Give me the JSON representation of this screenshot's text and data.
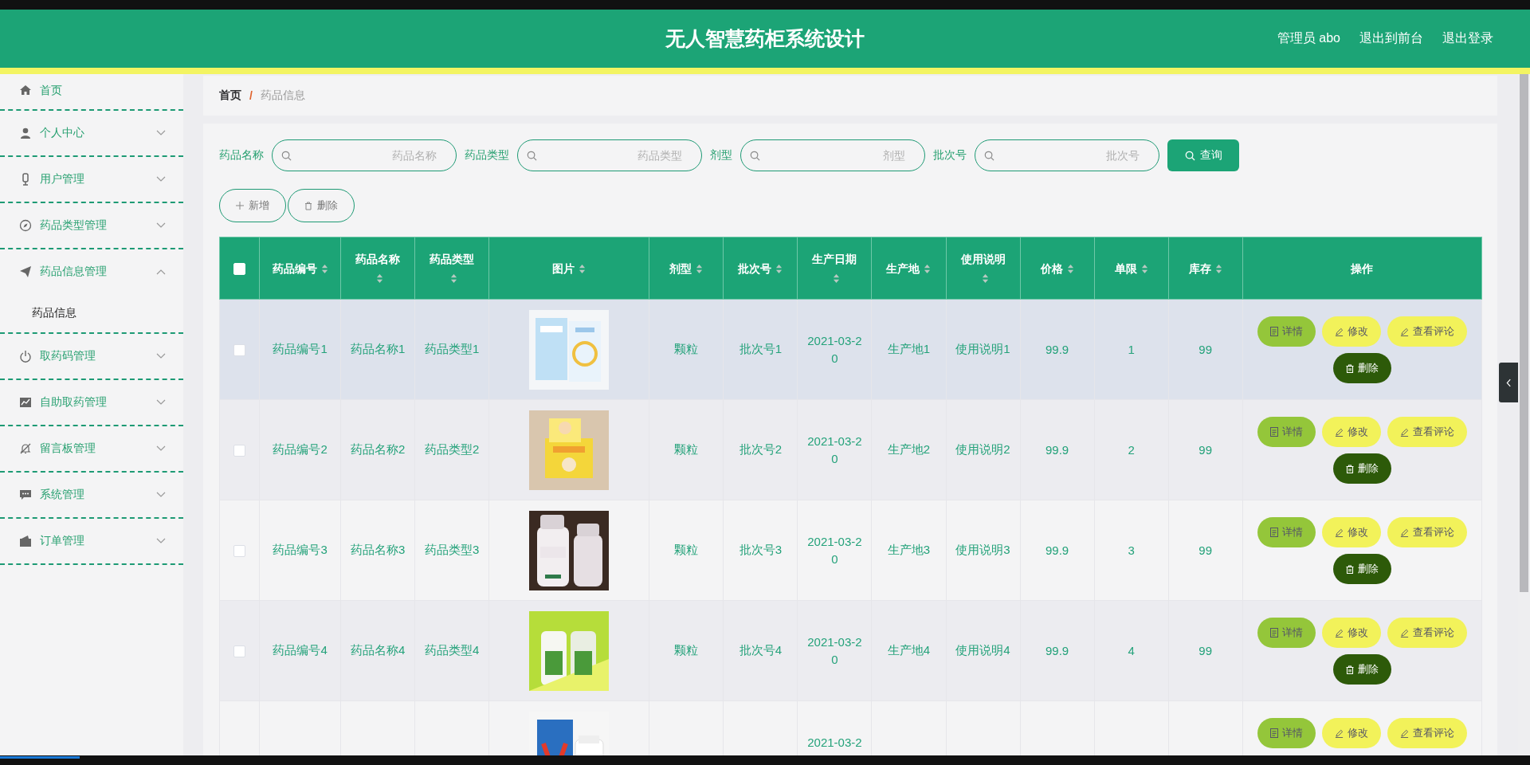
{
  "header": {
    "title": "无人智慧药柜系统设计",
    "links": [
      "管理员 abo",
      "退出到前台",
      "退出登录"
    ]
  },
  "sidebar": {
    "items": [
      {
        "label": "首页",
        "kind": "link"
      },
      {
        "label": "个人中心",
        "kind": "menu",
        "expanded": false
      },
      {
        "label": "用户管理",
        "kind": "menu",
        "expanded": false
      },
      {
        "label": "药品类型管理",
        "kind": "menu",
        "expanded": false
      },
      {
        "label": "药品信息管理",
        "kind": "menu",
        "expanded": true,
        "children": [
          {
            "label": "药品信息"
          }
        ]
      },
      {
        "label": "取药码管理",
        "kind": "menu",
        "expanded": false
      },
      {
        "label": "自助取药管理",
        "kind": "menu",
        "expanded": false
      },
      {
        "label": "留言板管理",
        "kind": "menu",
        "expanded": false
      },
      {
        "label": "系统管理",
        "kind": "menu",
        "expanded": false
      },
      {
        "label": "订单管理",
        "kind": "menu",
        "expanded": false
      }
    ]
  },
  "breadcrumb": [
    "首页",
    "/",
    "药品信息"
  ],
  "search": {
    "fields": [
      {
        "label": "药品名称",
        "placeholder": "药品名称"
      },
      {
        "label": "药品类型",
        "placeholder": "药品类型"
      },
      {
        "label": "剂型",
        "placeholder": "剂型"
      },
      {
        "label": "批次号",
        "placeholder": "批次号"
      }
    ],
    "button": "查询"
  },
  "toolbar": [
    {
      "label": "新增",
      "kind": "add"
    },
    {
      "label": "删除",
      "kind": "delete"
    }
  ],
  "table": {
    "all_checked": false,
    "columns": [
      {
        "label": "药品编号",
        "sortable": true
      },
      {
        "label": "药品名称",
        "sortable": true
      },
      {
        "label": "药品类型",
        "sortable": true
      },
      {
        "label": "图片",
        "sortable": true
      },
      {
        "label": "剂型",
        "sortable": true
      },
      {
        "label": "批次号",
        "sortable": true
      },
      {
        "label": "生产日期",
        "sortable": true
      },
      {
        "label": "生产地",
        "sortable": true
      },
      {
        "label": "使用说明",
        "sortable": true
      },
      {
        "label": "价格",
        "sortable": true
      },
      {
        "label": "单限",
        "sortable": true
      },
      {
        "label": "库存",
        "sortable": true
      },
      {
        "label": "操作",
        "sortable": false
      }
    ],
    "rows": [
      {
        "checked": false,
        "hovered": true,
        "cells": [
          "药品编号1",
          "药品名称1",
          "药品类型1",
          null,
          "颗粒",
          "批次号1",
          "2021-03-20",
          "生产地1",
          "使用说明1",
          "99.9",
          "1",
          "99"
        ],
        "actions": [
          {
            "label": "详情",
            "kind": "detail"
          },
          {
            "label": "修改",
            "kind": "edit"
          },
          {
            "label": "查看评论",
            "kind": "edit"
          },
          {
            "label": "删除",
            "kind": "delete"
          }
        ]
      },
      {
        "checked": false,
        "hovered": false,
        "cells": [
          "药品编号2",
          "药品名称2",
          "药品类型2",
          null,
          "颗粒",
          "批次号2",
          "2021-03-20",
          "生产地2",
          "使用说明2",
          "99.9",
          "2",
          "99"
        ],
        "actions": [
          {
            "label": "详情",
            "kind": "detail"
          },
          {
            "label": "修改",
            "kind": "edit"
          },
          {
            "label": "查看评论",
            "kind": "edit"
          },
          {
            "label": "删除",
            "kind": "delete"
          }
        ]
      },
      {
        "checked": false,
        "hovered": false,
        "cells": [
          "药品编号3",
          "药品名称3",
          "药品类型3",
          null,
          "颗粒",
          "批次号3",
          "2021-03-20",
          "生产地3",
          "使用说明3",
          "99.9",
          "3",
          "99"
        ],
        "actions": [
          {
            "label": "详情",
            "kind": "detail"
          },
          {
            "label": "修改",
            "kind": "edit"
          },
          {
            "label": "查看评论",
            "kind": "edit"
          },
          {
            "label": "删除",
            "kind": "delete"
          }
        ]
      },
      {
        "checked": false,
        "hovered": false,
        "cells": [
          "药品编号4",
          "药品名称4",
          "药品类型4",
          null,
          "颗粒",
          "批次号4",
          "2021-03-20",
          "生产地4",
          "使用说明4",
          "99.9",
          "4",
          "99"
        ],
        "actions": [
          {
            "label": "详情",
            "kind": "detail"
          },
          {
            "label": "修改",
            "kind": "edit"
          },
          {
            "label": "查看评论",
            "kind": "edit"
          },
          {
            "label": "删除",
            "kind": "delete"
          }
        ]
      },
      {
        "hovered": false,
        "cells": [
          null,
          null,
          null,
          null,
          null,
          null,
          "2021-03-2",
          null,
          null,
          null,
          null,
          null
        ],
        "actions": [
          {
            "label": "详情",
            "kind": "detail"
          },
          {
            "label": "修改",
            "kind": "edit"
          },
          {
            "label": "查看评论",
            "kind": "edit"
          }
        ]
      }
    ]
  }
}
